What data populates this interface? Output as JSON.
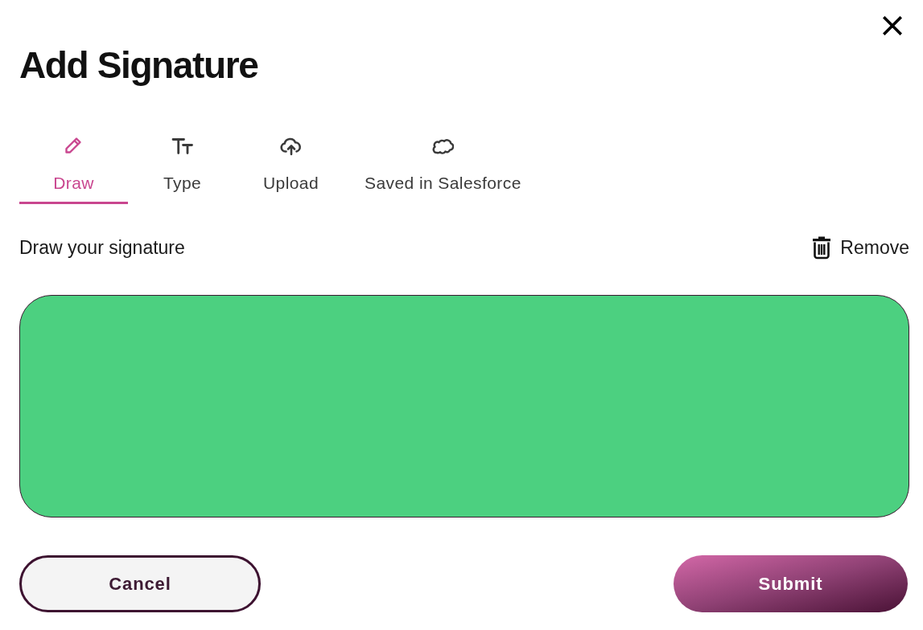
{
  "dialog": {
    "title": "Add Signature"
  },
  "tabs": [
    {
      "label": "Draw",
      "selected": true
    },
    {
      "label": "Type",
      "selected": false
    },
    {
      "label": "Upload",
      "selected": false
    },
    {
      "label": "Saved in Salesforce",
      "selected": false
    }
  ],
  "signature_area": {
    "label": "Draw your signature",
    "remove_button": "Remove"
  },
  "buttons": [
    {
      "label": "Cancel",
      "kind": "secondary"
    },
    {
      "label": "Submit",
      "kind": "primary"
    }
  ]
}
